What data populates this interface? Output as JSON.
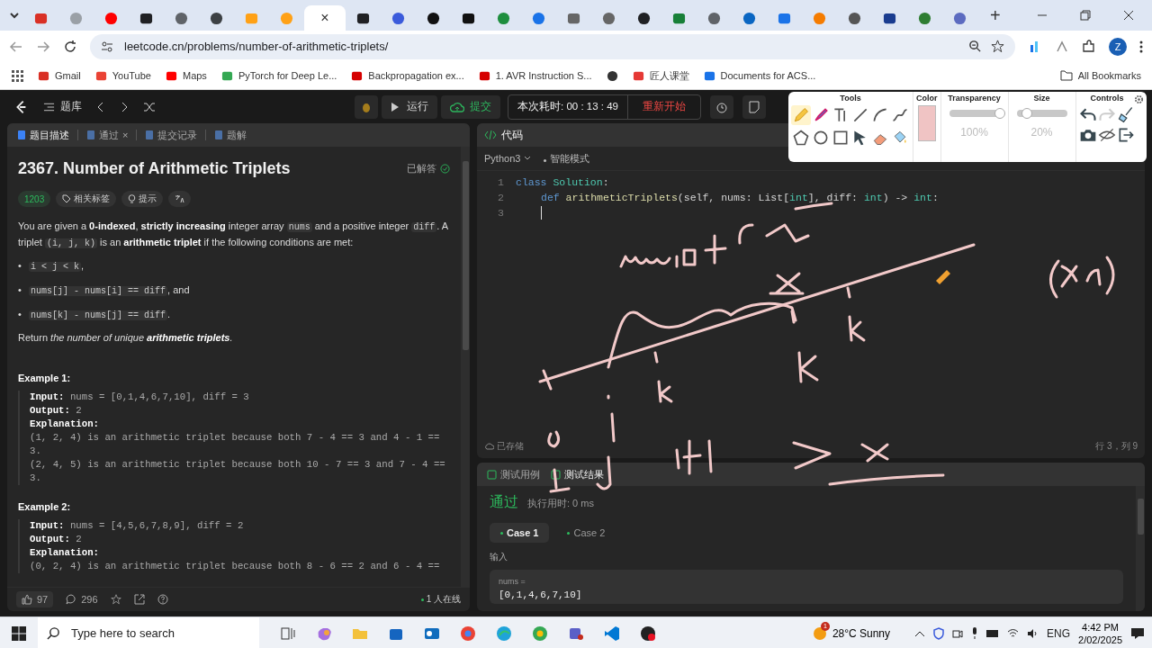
{
  "browser": {
    "tabs": [
      {
        "selected": false
      },
      {
        "selected": false
      },
      {
        "selected": false
      },
      {
        "selected": false
      },
      {
        "selected": false
      },
      {
        "selected": false
      },
      {
        "selected": false
      },
      {
        "selected": false
      },
      {
        "selected": true,
        "close": "×"
      },
      {
        "selected": false
      },
      {
        "selected": false
      },
      {
        "selected": false
      },
      {
        "selected": false
      },
      {
        "selected": false
      },
      {
        "selected": false
      },
      {
        "selected": false
      },
      {
        "selected": false
      },
      {
        "selected": false
      },
      {
        "selected": false
      },
      {
        "selected": false
      },
      {
        "selected": false
      },
      {
        "selected": false
      },
      {
        "selected": false
      },
      {
        "selected": false
      },
      {
        "selected": false
      },
      {
        "selected": false
      },
      {
        "selected": false
      }
    ],
    "new_tab": "+",
    "address": "leetcode.cn/problems/number-of-arithmetic-triplets/",
    "profile": "Z",
    "bookmarks": [
      {
        "kind": "link",
        "label": "Gmail"
      },
      {
        "kind": "link",
        "label": "YouTube"
      },
      {
        "kind": "link",
        "label": "Maps"
      },
      {
        "kind": "link",
        "label": "PyTorch for Deep Le..."
      },
      {
        "kind": "link",
        "label": "Backpropagation ex..."
      },
      {
        "kind": "link",
        "label": "1. AVR Instruction S..."
      },
      {
        "kind": "icon"
      },
      {
        "kind": "link",
        "label": "匠人课堂"
      },
      {
        "kind": "link",
        "label": "Documents for ACS..."
      }
    ],
    "all_bookmarks": "All Bookmarks"
  },
  "toolbar": {
    "problem_bank": "题库",
    "run": "运行",
    "submit": "提交",
    "timer": "本次耗时: 00 : 13 : 49",
    "restart": "重新开始"
  },
  "left_tabs": [
    {
      "label": "题目描述",
      "selected": true
    },
    {
      "label": "通过",
      "selected": false,
      "close": "×"
    },
    {
      "label": "提交记录",
      "selected": false
    },
    {
      "label": "题解",
      "selected": false
    }
  ],
  "problem": {
    "title": "2367. Number of Arithmetic Triplets",
    "status": "已解答",
    "rating": "1203",
    "tags": "相关标签",
    "hint": "提示",
    "intro": [
      {
        "kind": "plain",
        "text": "You are given a "
      },
      {
        "kind": "bold",
        "text": "0-indexed"
      },
      {
        "kind": "plain",
        "text": ", "
      },
      {
        "kind": "bold",
        "text": "strictly increasing"
      },
      {
        "kind": "plain",
        "text": " integer array "
      },
      {
        "kind": "code",
        "text": "nums"
      },
      {
        "kind": "plain",
        "text": " and a positive integer "
      },
      {
        "kind": "code",
        "text": "diff"
      },
      {
        "kind": "plain",
        "text": ". A triplet "
      },
      {
        "kind": "code",
        "text": "(i, j, k)"
      },
      {
        "kind": "plain",
        "text": " is an "
      },
      {
        "kind": "bold",
        "text": "arithmetic triplet"
      },
      {
        "kind": "plain",
        "text": " if the following conditions are met:"
      }
    ],
    "conditions": [
      {
        "marker": "•",
        "segments": [
          {
            "kind": "code",
            "text": "i < j < k"
          },
          {
            "kind": "plain",
            "text": ","
          }
        ]
      },
      {
        "marker": "•",
        "segments": [
          {
            "kind": "code",
            "text": "nums[j] - nums[i] == diff"
          },
          {
            "kind": "plain",
            "text": ", and"
          }
        ]
      },
      {
        "marker": "•",
        "segments": [
          {
            "kind": "code",
            "text": "nums[k] - nums[j] == diff"
          },
          {
            "kind": "plain",
            "text": "."
          }
        ]
      }
    ],
    "task": [
      {
        "kind": "plain",
        "text": "Return "
      },
      {
        "kind": "italic",
        "text": "the number of unique "
      },
      {
        "kind": "bold-italic",
        "text": "arithmetic triplets"
      },
      {
        "kind": "italic",
        "text": "."
      }
    ],
    "examples": [
      {
        "title": "Example 1:",
        "lines": [
          {
            "label": "Input:",
            "value": "nums = [0,1,4,6,7,10], diff = 3"
          },
          {
            "label": "Output:",
            "value": "2"
          },
          {
            "label": "Explanation:"
          },
          {
            "value": "(1, 2, 4) is an arithmetic triplet because both 7 - 4 == 3 and 4 - 1 == 3."
          },
          {
            "value": "(2, 4, 5) is an arithmetic triplet because both 10 - 7 == 3 and 7 - 4 == 3."
          }
        ]
      },
      {
        "title": "Example 2:",
        "lines": [
          {
            "label": "Input:",
            "value": "nums = [4,5,6,7,8,9], diff = 2"
          },
          {
            "label": "Output:",
            "value": "2"
          },
          {
            "label": "Explanation:"
          },
          {
            "value": "(0, 2, 4) is an arithmetic triplet because both 8 - 6 == 2 and 6 - 4 =="
          }
        ]
      }
    ],
    "likes": "97",
    "comments": "296",
    "online": "1 人在线"
  },
  "editor": {
    "tab": "代码",
    "language": "Python3",
    "mode": "智能模式",
    "lines": [
      {
        "number": "1",
        "indented": false,
        "tokens": [
          {
            "kind": "keyword",
            "text": "class "
          },
          {
            "kind": "class",
            "text": "Solution"
          },
          {
            "kind": "plain",
            "text": ":"
          }
        ]
      },
      {
        "number": "2",
        "indented": true,
        "tokens": [
          {
            "kind": "keyword",
            "text": "def "
          },
          {
            "kind": "function",
            "text": "arithmeticTriplets"
          },
          {
            "kind": "plain",
            "text": "(self, nums: List["
          },
          {
            "kind": "type",
            "text": "int"
          },
          {
            "kind": "plain",
            "text": "], diff: "
          },
          {
            "kind": "type",
            "text": "int"
          },
          {
            "kind": "plain",
            "text": ") -> "
          },
          {
            "kind": "type",
            "text": "int"
          },
          {
            "kind": "plain",
            "text": ":"
          }
        ]
      },
      {
        "number": "3",
        "indented": true,
        "cursor": true
      }
    ],
    "saved": "已存储",
    "position": "行 3，列 9"
  },
  "tests": {
    "tabs": [
      {
        "label": "测试用例",
        "selected": false
      },
      {
        "label": "测试结果",
        "selected": true
      }
    ],
    "result": "通过",
    "runtime": "执行用时: 0 ms",
    "cases": [
      {
        "label": "Case 1",
        "selected": true
      },
      {
        "label": "Case 2",
        "selected": false
      }
    ],
    "input_label": "输入",
    "input_name": "nums =",
    "input_value": "[0,1,4,6,7,10]"
  },
  "pen_tools": {
    "tools_title": "Tools",
    "tools": [
      {
        "selected": true
      },
      {
        "selected": false
      },
      {
        "selected": false
      },
      {
        "selected": false
      },
      {
        "selected": false
      },
      {
        "selected": false
      },
      {
        "selected": false
      },
      {
        "selected": false
      },
      {
        "selected": false
      },
      {
        "selected": false
      },
      {
        "selected": false
      },
      {
        "selected": false
      }
    ],
    "color_title": "Color",
    "color": "#f0c4c4",
    "transparency_title": "Transparency",
    "transparency": {
      "level": 1,
      "reading": "100%"
    },
    "size_title": "Size",
    "size": {
      "level": 0.2,
      "reading": "20%"
    },
    "controls_title": "Controls"
  },
  "taskbar": {
    "search_placeholder": "Type here to search",
    "weather_badge": "1",
    "weather": "28°C  Sunny",
    "language": "ENG",
    "time": "4:42 PM",
    "date": "2/02/2025"
  }
}
